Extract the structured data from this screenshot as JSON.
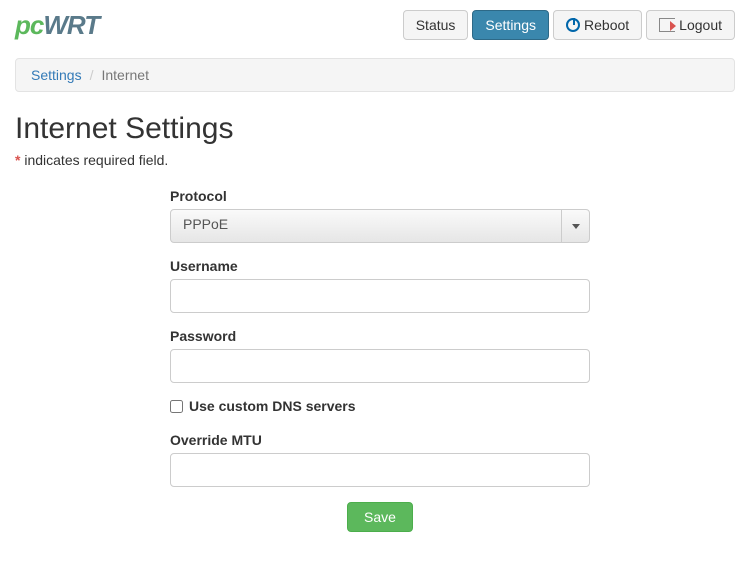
{
  "logo": {
    "pc": "pc",
    "wrt": "WRT"
  },
  "nav": {
    "status": "Status",
    "settings": "Settings",
    "reboot": "Reboot",
    "logout": "Logout"
  },
  "breadcrumb": {
    "root": "Settings",
    "current": "Internet"
  },
  "page": {
    "title": "Internet Settings",
    "required_note": "indicates required field."
  },
  "form": {
    "protocol_label": "Protocol",
    "protocol_value": "PPPoE",
    "username_label": "Username",
    "username_value": "",
    "password_label": "Password",
    "password_value": "",
    "dns_label": "Use custom DNS servers",
    "mtu_label": "Override MTU",
    "mtu_value": "",
    "save_label": "Save"
  }
}
